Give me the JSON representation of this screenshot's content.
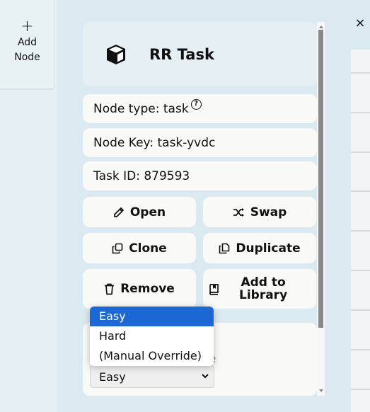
{
  "left": {
    "add_node": {
      "icon": "+",
      "label_line1": "Add",
      "label_line2": "Node"
    }
  },
  "close": {
    "icon": "×"
  },
  "panel": {
    "title": "RR Task",
    "node_type": "Node type: task",
    "help_icon": "?",
    "node_key": "Node Key: task-yvdc",
    "task_id": "Task ID: 879593"
  },
  "buttons": {
    "open": "Open",
    "swap": "Swap",
    "clone": "Clone",
    "duplicate": "Duplicate",
    "remove": "Remove",
    "add_to_library_line1": "Add to",
    "add_to_library_line2": "Library"
  },
  "difficulty": {
    "hidden_label_fragment": "use",
    "selected": "Easy",
    "options": [
      "Easy",
      "Hard",
      "(Manual Override)"
    ]
  },
  "colors": {
    "accent": "#1b67d3",
    "background": "#dbe9f1",
    "card": "#f9f9f7"
  }
}
